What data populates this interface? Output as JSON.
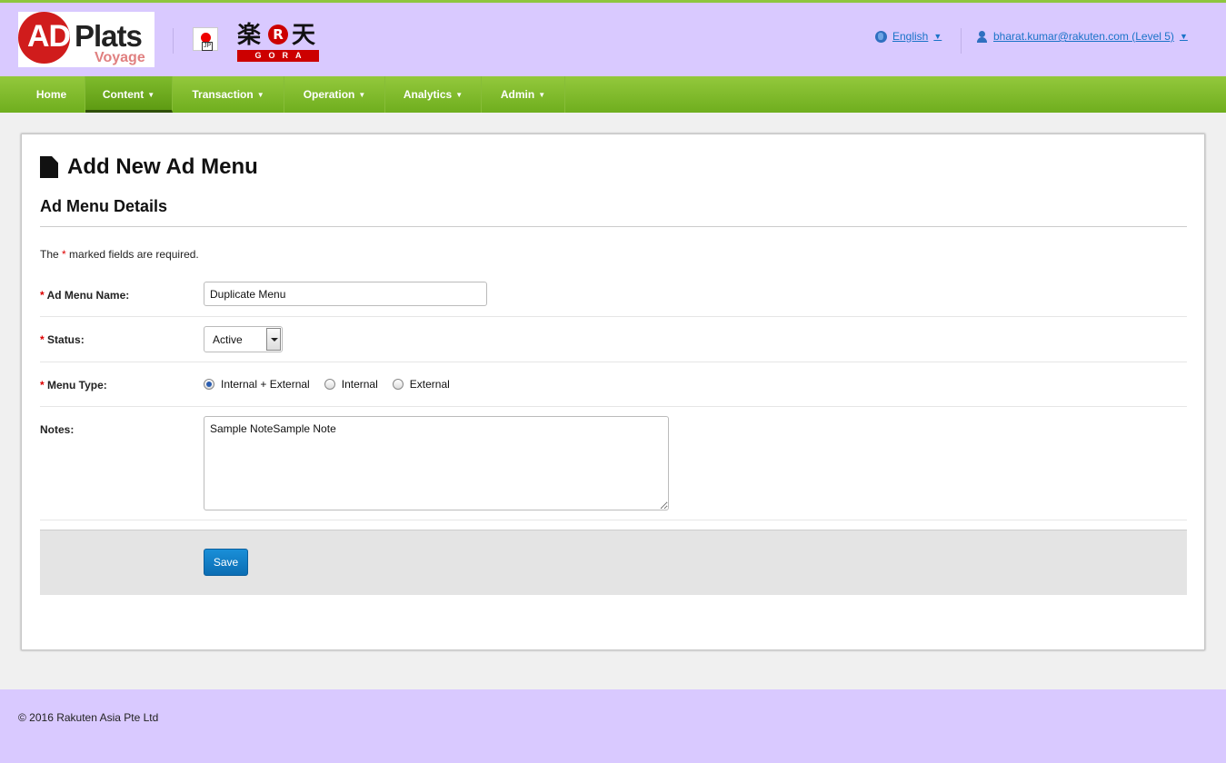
{
  "header": {
    "logo": {
      "ad": "AD",
      "plats": "Plats",
      "sub": "Voyage"
    },
    "region_flag_tag": "JP",
    "partner_logo": {
      "top_chars": "楽",
      "r": "R",
      "right_char": "天",
      "sub": "GORA"
    },
    "language_label": "English",
    "user_label": "bharat.kumar@rakuten.com (Level 5)"
  },
  "nav": {
    "items": [
      {
        "label": "Home"
      },
      {
        "label": "Content"
      },
      {
        "label": "Transaction"
      },
      {
        "label": "Operation"
      },
      {
        "label": "Analytics"
      },
      {
        "label": "Admin"
      }
    ],
    "active": "Content"
  },
  "page": {
    "title": "Add New Ad Menu",
    "section_title": "Ad Menu Details",
    "required_note_prefix": "The ",
    "required_star": "*",
    "required_note_suffix": " marked fields are required."
  },
  "form": {
    "name_label": "Ad Menu Name:",
    "name_value": "Duplicate Menu",
    "status_label": "Status:",
    "status_value": "Active",
    "menu_type_label": "Menu Type:",
    "menu_type_options": [
      "Internal + External",
      "Internal",
      "External"
    ],
    "menu_type_selected": "Internal + External",
    "notes_label": "Notes:",
    "notes_value": "Sample NoteSample Note",
    "save_label": "Save"
  },
  "footer": {
    "copyright": "© 2016 Rakuten Asia Pte Ltd"
  },
  "colors": {
    "header_bg": "#d9c9ff",
    "nav_green": "#7fbb2c",
    "link_blue": "#1a73c8",
    "save_blue": "#0b6db3",
    "required_red": "#dd0000"
  }
}
